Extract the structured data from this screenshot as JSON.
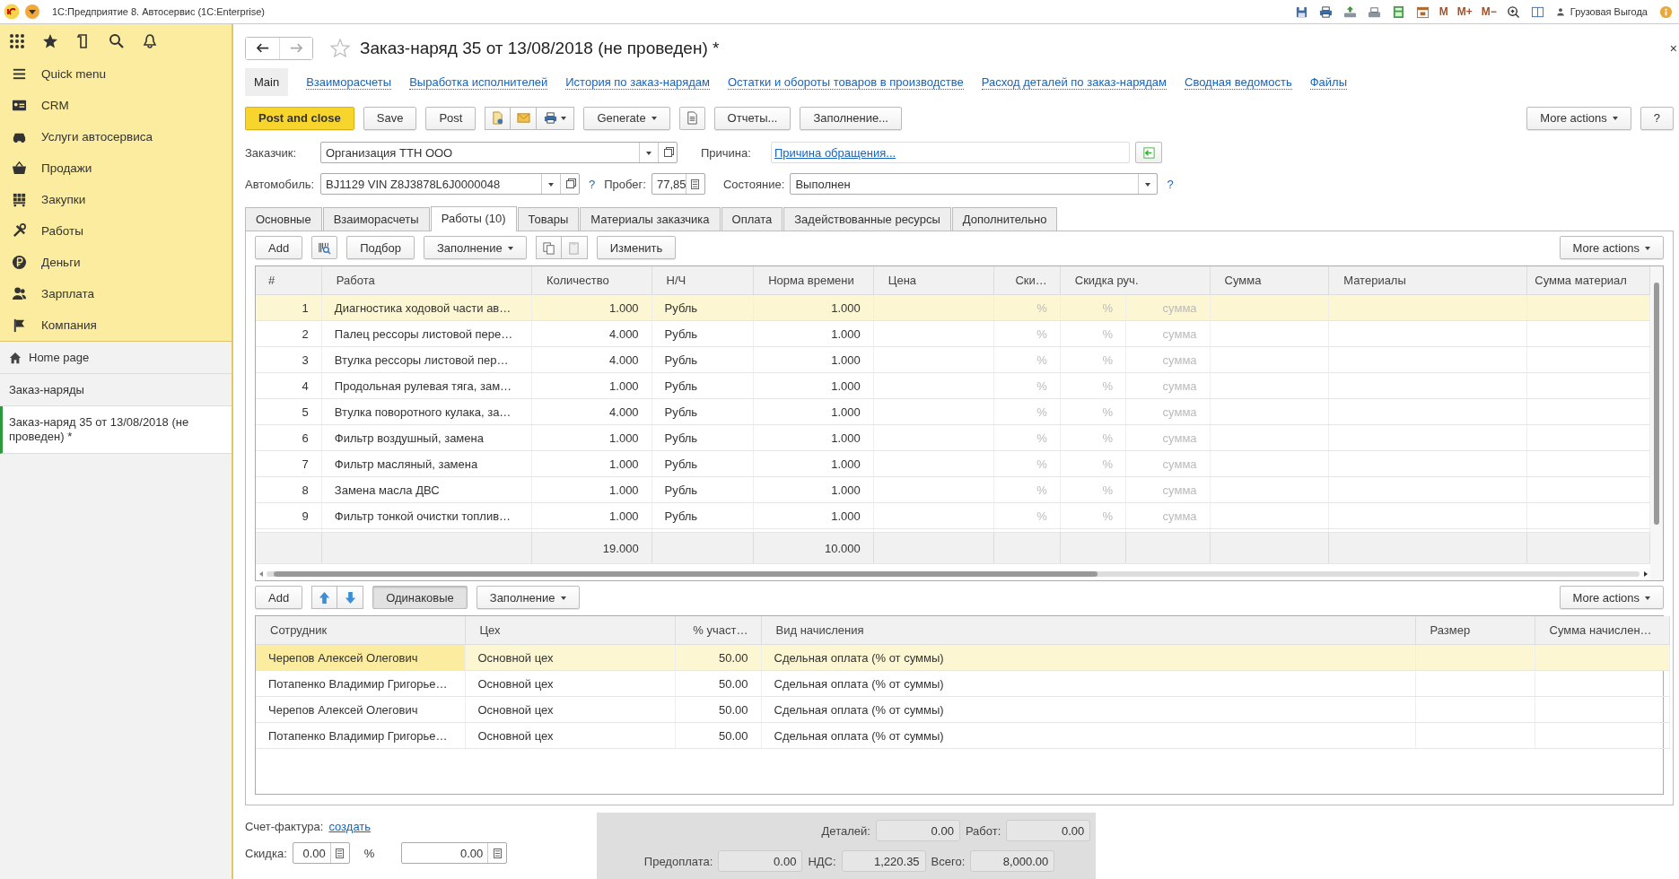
{
  "app_bar": {
    "title": "1С:Предприятие 8. Автосервис  (1C:Enterprise)",
    "memory_buttons": [
      "M",
      "M+",
      "M−"
    ],
    "user": "Грузовая Выгода"
  },
  "sidebar": {
    "items": [
      {
        "label": "Quick menu"
      },
      {
        "label": "CRM"
      },
      {
        "label": "Услуги автосервиса"
      },
      {
        "label": "Продажи"
      },
      {
        "label": "Закупки"
      },
      {
        "label": "Работы"
      },
      {
        "label": "Деньги"
      },
      {
        "label": "Зарплата"
      },
      {
        "label": "Компания"
      }
    ],
    "open_windows": [
      {
        "label": "Home page",
        "kind": "home",
        "selected": false
      },
      {
        "label": "Заказ-наряды",
        "kind": "list",
        "selected": false
      },
      {
        "label": "Заказ-наряд 35 от 13/08/2018 (не проведен) *",
        "kind": "document",
        "selected": true
      }
    ]
  },
  "document": {
    "title": "Заказ-наряд 35 от 13/08/2018 (не проведен) *",
    "favorite": false,
    "close_glyph": "×"
  },
  "sections": [
    {
      "label": "Main",
      "selected": true
    },
    {
      "label": "Взаиморасчеты",
      "selected": false
    },
    {
      "label": "Выработка исполнителей",
      "selected": false
    },
    {
      "label": "История по заказ-нарядам",
      "selected": false
    },
    {
      "label": "Остатки и обороты товаров в производстве",
      "selected": false
    },
    {
      "label": "Расход деталей по заказ-нарядам",
      "selected": false
    },
    {
      "label": "Сводная ведомость",
      "selected": false
    },
    {
      "label": "Файлы",
      "selected": false
    }
  ],
  "toolbar": {
    "left": [
      {
        "label": "Post and close",
        "kind": "primary"
      },
      {
        "label": "Save",
        "kind": "plain"
      },
      {
        "label": "Post",
        "kind": "plain"
      },
      {
        "label": "Generate",
        "kind": "dropdown"
      },
      {
        "label": "Отчеты...",
        "kind": "plain"
      },
      {
        "label": "Заполнение...",
        "kind": "plain"
      }
    ],
    "right": [
      {
        "label": "More actions",
        "kind": "dropdown"
      },
      {
        "label": "?",
        "kind": "plain"
      }
    ]
  },
  "fields": {
    "customer": {
      "label": "Заказчик:",
      "value": "Организация ТТН ООО"
    },
    "reason": {
      "label": "Причина:",
      "link": "Причина обращения..."
    },
    "car": {
      "label": "Автомобиль:",
      "value": "BJ1129 VIN Z8J3878L6J0000048",
      "help": "?"
    },
    "mileage": {
      "label": "Пробег:",
      "value": "77,85"
    },
    "state": {
      "label": "Состояние:",
      "value": "Выполнен",
      "help": "?"
    }
  },
  "tabs": [
    {
      "label": "Основные",
      "selected": false
    },
    {
      "label": "Взаиморасчеты",
      "selected": false
    },
    {
      "label": "Работы (10)",
      "selected": true
    },
    {
      "label": "Товары",
      "selected": false
    },
    {
      "label": "Материалы заказчика",
      "selected": false
    },
    {
      "label": "Оплата",
      "selected": false
    },
    {
      "label": "Задействованные ресурсы",
      "selected": false
    },
    {
      "label": "Дополнительно",
      "selected": false
    }
  ],
  "works_toolbar": {
    "add": "Add",
    "pick": "Подбор",
    "fill": "Заполнение",
    "change": "Изменить",
    "more": "More actions"
  },
  "works_table": {
    "columns": [
      {
        "label": "#",
        "kind": "single"
      },
      {
        "label": "Работа",
        "kind": "single"
      },
      {
        "label": "Количество",
        "kind": "single"
      },
      {
        "label": "Н/Ч",
        "kind": "single"
      },
      {
        "label": "Норма времени",
        "kind": "single"
      },
      {
        "label": "Цена",
        "kind": "single"
      },
      {
        "label": "Ски…",
        "kind": "single"
      },
      {
        "label": "Скидка руч.",
        "kind": "double"
      },
      {
        "label": "Сумма",
        "kind": "single"
      },
      {
        "label": "Материалы",
        "kind": "single"
      },
      {
        "label": "Сумма материал",
        "kind": "single"
      }
    ],
    "rows": [
      {
        "num": "1",
        "work": "Диагностика ходовой части ав…",
        "qty": "1.000",
        "unit": "Рубль",
        "norm": "1.000",
        "discount": "%",
        "manual_discount": "%",
        "manual_sum": "сумма",
        "selected": true
      },
      {
        "num": "2",
        "work": "Палец рессоры листовой пере…",
        "qty": "4.000",
        "unit": "Рубль",
        "norm": "1.000",
        "discount": "%",
        "manual_discount": "%",
        "manual_sum": "сумма",
        "selected": false
      },
      {
        "num": "3",
        "work": "Втулка рессоры листовой пер…",
        "qty": "4.000",
        "unit": "Рубль",
        "norm": "1.000",
        "discount": "%",
        "manual_discount": "%",
        "manual_sum": "сумма",
        "selected": false
      },
      {
        "num": "4",
        "work": "Продольная рулевая тяга, зам…",
        "qty": "1.000",
        "unit": "Рубль",
        "norm": "1.000",
        "discount": "%",
        "manual_discount": "%",
        "manual_sum": "сумма",
        "selected": false
      },
      {
        "num": "5",
        "work": "Втулка поворотного кулака, за…",
        "qty": "4.000",
        "unit": "Рубль",
        "norm": "1.000",
        "discount": "%",
        "manual_discount": "%",
        "manual_sum": "сумма",
        "selected": false
      },
      {
        "num": "6",
        "work": "Фильтр воздушный, замена",
        "qty": "1.000",
        "unit": "Рубль",
        "norm": "1.000",
        "discount": "%",
        "manual_discount": "%",
        "manual_sum": "сумма",
        "selected": false
      },
      {
        "num": "7",
        "work": "Фильтр масляный, замена",
        "qty": "1.000",
        "unit": "Рубль",
        "norm": "1.000",
        "discount": "%",
        "manual_discount": "%",
        "manual_sum": "сумма",
        "selected": false
      },
      {
        "num": "8",
        "work": "Замена масла ДВС",
        "qty": "1.000",
        "unit": "Рубль",
        "norm": "1.000",
        "discount": "%",
        "manual_discount": "%",
        "manual_sum": "сумма",
        "selected": false
      },
      {
        "num": "9",
        "work": "Фильтр тонкой очистки топлив…",
        "qty": "1.000",
        "unit": "Рубль",
        "norm": "1.000",
        "discount": "%",
        "manual_discount": "%",
        "manual_sum": "сумма",
        "selected": false
      }
    ],
    "totals": {
      "qty": "19.000",
      "norm": "10.000"
    }
  },
  "staff_toolbar": {
    "add": "Add",
    "same": "Одинаковые",
    "same_pressed": true,
    "fill": "Заполнение",
    "more": "More actions"
  },
  "staff_table": {
    "columns": [
      "Сотрудник",
      "Цех",
      "% участ…",
      "Вид начисления",
      "Размер",
      "Сумма начислен…"
    ],
    "rows": [
      {
        "employee": "Черепов Алексей Олегович",
        "shop": "Основной цех",
        "share": "50.00",
        "accrual": "Сдельная оплата (% от суммы)",
        "selected": true
      },
      {
        "employee": "Потапенко Владимир Григорье…",
        "shop": "Основной цех",
        "share": "50.00",
        "accrual": "Сдельная оплата (% от суммы)",
        "selected": false
      },
      {
        "employee": "Черепов Алексей Олегович",
        "shop": "Основной цех",
        "share": "50.00",
        "accrual": "Сдельная оплата (% от суммы)",
        "selected": false
      },
      {
        "employee": "Потапенко Владимир Григорье…",
        "shop": "Основной цех",
        "share": "50.00",
        "accrual": "Сдельная оплата (% от суммы)",
        "selected": false
      }
    ]
  },
  "footer": {
    "invoice": {
      "label": "Счет-фактура:",
      "link": "создать"
    },
    "discount": {
      "label": "Скидка:",
      "percent": "0.00",
      "unit": "%",
      "amount": "0.00"
    },
    "totals": [
      [
        {
          "label": "Деталей:",
          "value": "0.00"
        },
        {
          "label": "Работ:",
          "value": "0.00"
        }
      ],
      [
        {
          "label": "Предоплата:",
          "value": "0.00"
        },
        {
          "label": "НДС:",
          "value": "1,220.35"
        },
        {
          "label": "Всего:",
          "value": "8,000.00"
        }
      ]
    ]
  }
}
